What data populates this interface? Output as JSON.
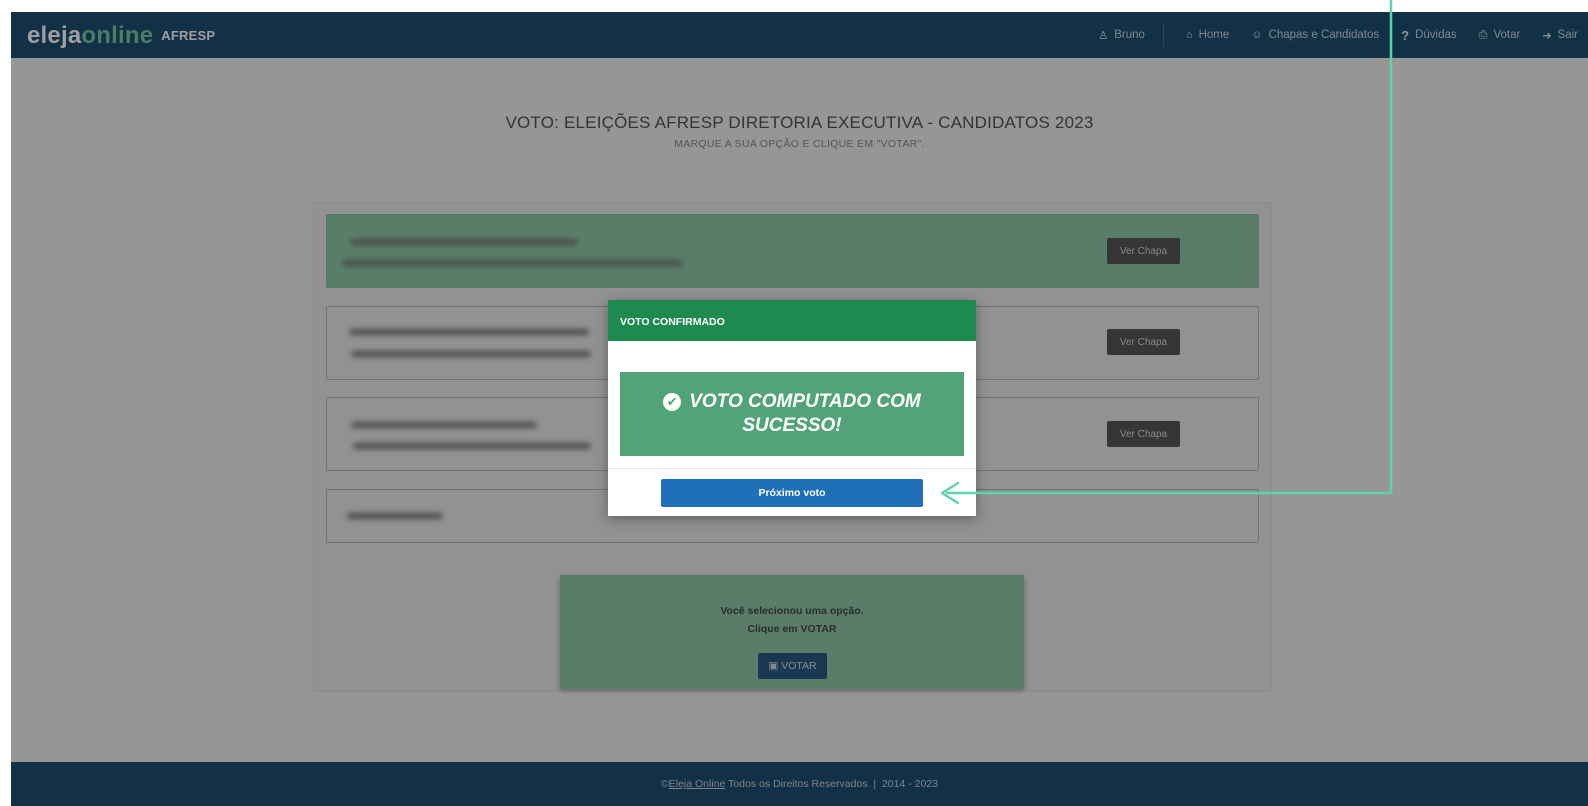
{
  "brand": {
    "part1": "eleja",
    "part2": "online",
    "org": "AFRESP"
  },
  "nav": {
    "user": "Bruno",
    "home": "Home",
    "chapas": "Chapas e Candidatos",
    "duvidas": "Dúvidas",
    "votar": "Votar",
    "sair": "Sair"
  },
  "page": {
    "title": "VOTO: ELEIÇÕES AFRESP DIRETORIA EXECUTIVA - CANDIDATOS 2023",
    "subtitle": "MARQUE A SUA OPÇÃO E CLIQUE EM \"VOTAR\"."
  },
  "options": {
    "view_button": "Ver Chapa"
  },
  "vote_panel": {
    "line1": "Você selecionou uma opção.",
    "line2": "Clique em VOTAR",
    "button": "VOTAR"
  },
  "modal": {
    "header": "VOTO CONFIRMADO",
    "message": "VOTO COMPUTADO COM SUCESSO!",
    "next_button": "Próximo voto"
  },
  "footer": {
    "prefix": "©",
    "link": "Eleja Online",
    "text": " Todos os Direitos Reservados  |  2014 - 2023"
  },
  "colors": {
    "navbar": "#1d4f73",
    "modal_header": "#1e8a4f",
    "success": "#52a478",
    "primary_button": "#1f70b7",
    "annotation": "#5fd3a8"
  }
}
